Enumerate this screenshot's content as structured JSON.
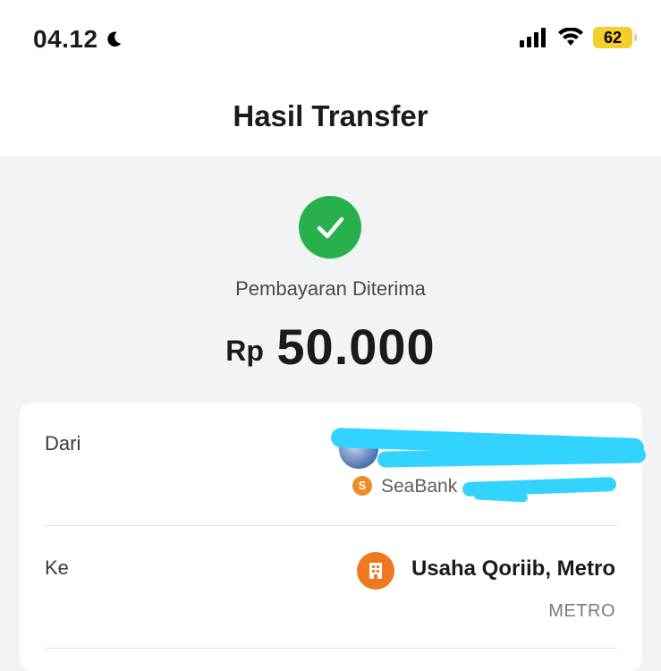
{
  "status_bar": {
    "time": "04.12",
    "battery": "62"
  },
  "header": {
    "title": "Hasil Transfer"
  },
  "result": {
    "status_text": "Pembayaran Diterima",
    "currency": "Rp",
    "amount": "50.000"
  },
  "details": {
    "from": {
      "label": "Dari",
      "bank": "SeaBank"
    },
    "to": {
      "label": "Ke",
      "merchant_name": "Usaha Qoriib, Metro",
      "city": "METRO"
    }
  },
  "colors": {
    "success": "#27b04b",
    "merchant": "#f0781e",
    "seabank": "#f08a24",
    "battery": "#f5cf29"
  }
}
